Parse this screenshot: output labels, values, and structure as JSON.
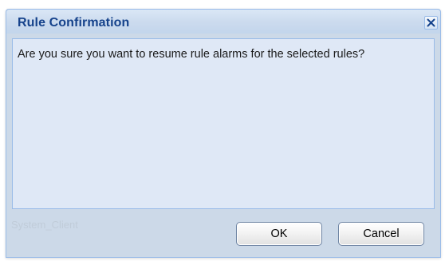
{
  "dialog": {
    "title": "Rule Confirmation",
    "message": "Are you sure you want to resume rule alarms for the selected rules?",
    "background_text": "System_Client",
    "close_icon": "close-icon",
    "ok_label": "OK",
    "cancel_label": "Cancel"
  },
  "colors": {
    "title_text": "#15428b",
    "dialog_bg": "#ccd9e8",
    "body_bg": "#dfe8f6",
    "border": "#99bbe8"
  }
}
